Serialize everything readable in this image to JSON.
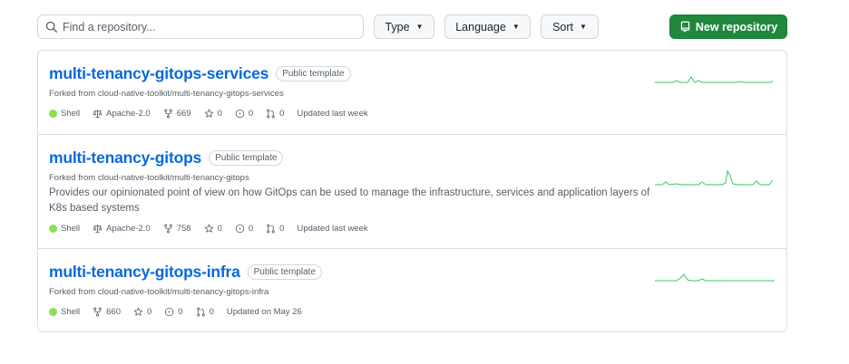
{
  "search": {
    "placeholder": "Find a repository..."
  },
  "filters": {
    "type_label": "Type",
    "language_label": "Language",
    "sort_label": "Sort",
    "new_repo_label": "New repository"
  },
  "colors": {
    "accent": "#0969da",
    "new_button": "#1f883d",
    "shell": "#89e051",
    "spark": "#40c463"
  },
  "repos": [
    {
      "name": "multi-tenancy-gitops-services",
      "badge": "Public template",
      "forked_from": "Forked from cloud-native-toolkit/multi-tenancy-gitops-services",
      "description": "",
      "language": "Shell",
      "license": "Apache-2.0",
      "forks": "669",
      "stars": "0",
      "issues": "0",
      "prs": "0",
      "updated": "Updated last week"
    },
    {
      "name": "multi-tenancy-gitops",
      "badge": "Public template",
      "forked_from": "Forked from cloud-native-toolkit/multi-tenancy-gitops",
      "description": "Provides our opinionated point of view on how GitOps can be used to manage the infrastructure, services and application layers of K8s based systems",
      "language": "Shell",
      "license": "Apache-2.0",
      "forks": "758",
      "stars": "0",
      "issues": "0",
      "prs": "0",
      "updated": "Updated last week"
    },
    {
      "name": "multi-tenancy-gitops-infra",
      "badge": "Public template",
      "forked_from": "Forked from cloud-native-toolkit/multi-tenancy-gitops-infra",
      "description": "",
      "language": "Shell",
      "forks": "660",
      "stars": "0",
      "issues": "0",
      "prs": "0",
      "updated": "Updated on May 26"
    }
  ]
}
